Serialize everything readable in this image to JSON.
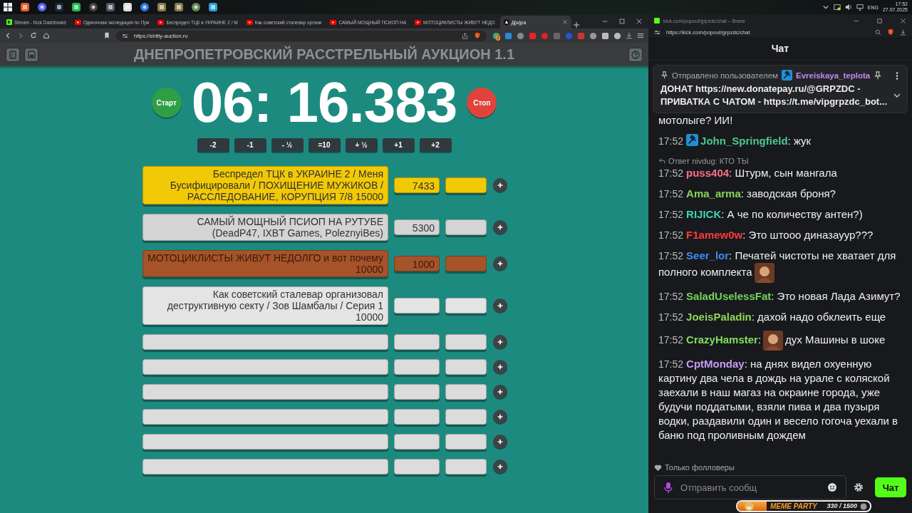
{
  "taskbar": {
    "language": "ENG",
    "time": "17:52",
    "date": "27.07.2025"
  },
  "browser": {
    "tabs": [
      {
        "title": "Stream - Kick Dashboard",
        "kind": "kick",
        "selected": false
      },
      {
        "title": "Одиночная экспедиция по При",
        "kind": "video",
        "selected": false
      },
      {
        "title": "Беспредел ТЦК в УКРАИНЕ 2 / М",
        "kind": "video",
        "selected": false
      },
      {
        "title": "Как советский сталевар органи",
        "kind": "video",
        "selected": false
      },
      {
        "title": "САМЫЙ МОЩНЫЙ ПСИОП НА",
        "kind": "video",
        "selected": false
      },
      {
        "title": "МОТОЦИКЛИСТЫ ЖИВУТ НЕДО",
        "kind": "video",
        "selected": false
      },
      {
        "title": "Д(ы)ра",
        "kind": "site",
        "selected": true
      }
    ],
    "url": "https://shitty-auction.ru",
    "extension_badge": "2"
  },
  "auction": {
    "title": "ДНЕПРОПЕТРОВСКИЙ РАССТРЕЛЬНЫЙ АУКЦИОН 1.1",
    "start": "Старт",
    "timer": "06: 16.383",
    "stop": "Стоп",
    "adjust": [
      "-2",
      "-1",
      "- ½",
      "=10",
      "+ ½",
      "+1",
      "+2"
    ],
    "lots": [
      {
        "name": "Беспредел ТЦК в УКРАИНЕ 2 / Меня Бусифицировали / ПОХИЩЕНИЕ МУЖИКОВ / РАССЛЕДОВАНИЕ, КОРУПЦИЯ 7/8 15000",
        "amount": "7433",
        "color": "#f2c906"
      },
      {
        "name": "САМЫЙ МОЩНЫЙ ПСИОП НА РУТУБЕ (DeadP47, IXBT Games, PoleznyiBes)",
        "amount": "5300",
        "color": "#d4d4d4"
      },
      {
        "name": "МОТОЦИКЛИСТЫ ЖИВУТ НЕДОЛГО и вот почему 10000",
        "amount": "1000",
        "color": "#a6532a"
      },
      {
        "name": "Как советский сталевар организовал деструктивную секту / Зов Шамбалы / Серия 1 10000",
        "color": "#e4e4e4"
      },
      {
        "color": "#dcdcdc"
      },
      {
        "color": "#dcdcdc"
      },
      {
        "color": "#dcdcdc"
      },
      {
        "color": "#dcdcdc"
      },
      {
        "color": "#dcdcdc"
      },
      {
        "color": "#dcdcdc"
      }
    ]
  },
  "chat": {
    "window_title": "kick.com/popout/grpzdc/chat – Brave",
    "url": "https://kick.com/popout/grpzdc/chat",
    "header": "Чат",
    "pinned": {
      "label": "Отправлено пользователем",
      "badge": true,
      "user": "Evreiskaya_teplota",
      "parts": [
        {
          "kind": "text",
          "text": "ДОНАТ "
        },
        {
          "kind": "link",
          "text": "https://new.donatepay.ru/@GRPZDC"
        },
        {
          "kind": "text",
          "text": " - ПРИВАТКА С ЧАТОМ - "
        },
        {
          "kind": "link",
          "text": "https://t.me/vipgrpzdc_bot..."
        }
      ]
    },
    "messages": [
      {
        "kind": "continuation",
        "parts": [
          {
            "kind": "text",
            "text": "мотолыге? ИИ!"
          }
        ]
      },
      {
        "kind": "message",
        "time": "17:52",
        "badge": true,
        "user": "John_Springfield",
        "color": "#4cc98a",
        "parts": [
          {
            "kind": "text",
            "text": ": жук"
          }
        ]
      },
      {
        "kind": "message",
        "reply": "Ответ nivdug: КТО ТЫ",
        "time": "17:52",
        "badge": false,
        "user": "puss404",
        "color": "#ff6e8a",
        "parts": [
          {
            "kind": "text",
            "text": ": Штурм, сын мангала"
          }
        ]
      },
      {
        "kind": "message",
        "time": "17:52",
        "badge": false,
        "user": "Ama_arma",
        "color": "#8ad45a",
        "parts": [
          {
            "kind": "text",
            "text": ": заводская броня?"
          }
        ]
      },
      {
        "kind": "message",
        "time": "17:52",
        "badge": false,
        "user": "RIJICK",
        "color": "#3ad6b0",
        "parts": [
          {
            "kind": "text",
            "text": ": А че по количеству антен?)"
          }
        ]
      },
      {
        "kind": "message",
        "time": "17:52",
        "badge": false,
        "user": "F1amew0w",
        "color": "#ff3b3b",
        "parts": [
          {
            "kind": "text",
            "text": ": Это штооо диназауур???"
          }
        ]
      },
      {
        "kind": "message",
        "time": "17:52",
        "badge": false,
        "user": "Seer_lor",
        "color": "#3d8df5",
        "parts": [
          {
            "kind": "text",
            "text": ": Печатей чистоты не хватает для полного комплекта"
          },
          {
            "kind": "emote"
          }
        ]
      },
      {
        "kind": "message",
        "time": "17:52",
        "badge": false,
        "user": "SaladUselessFat",
        "color": "#74d45b",
        "parts": [
          {
            "kind": "text",
            "text": ": Это новая Лада Азимут?"
          }
        ]
      },
      {
        "kind": "message",
        "time": "17:52",
        "badge": false,
        "user": "JoeisPaladin",
        "color": "#8fd456",
        "parts": [
          {
            "kind": "text",
            "text": ": дахой надо обклеить еще"
          }
        ]
      },
      {
        "kind": "message",
        "time": "17:52",
        "badge": false,
        "user": "CrazyHamster",
        "color": "#7fe05c",
        "parts": [
          {
            "kind": "text",
            "text": ":"
          },
          {
            "kind": "emote"
          },
          {
            "kind": "text",
            "text": "дух Машины в шоке"
          }
        ]
      },
      {
        "kind": "message",
        "time": "17:52",
        "badge": false,
        "user": "CptMonday",
        "color": "#c79cf5",
        "parts": [
          {
            "kind": "text",
            "text": ": на днях видел охуенную картину два чела в дождь на урале с коляской заехали в наш магаз на окраине города, уже будучи поддатыми, взяли пива и два пузыря водки, раздавили один и весело гогоча уехали в баню под проливным дождем"
          }
        ]
      }
    ],
    "followers_only": "Только фолловеры",
    "placeholder": "Отправить сообщ",
    "send": "Чат",
    "meme_party": {
      "title": "MEME PARTY",
      "progress": "330 / 1500",
      "level": 0.22
    }
  }
}
